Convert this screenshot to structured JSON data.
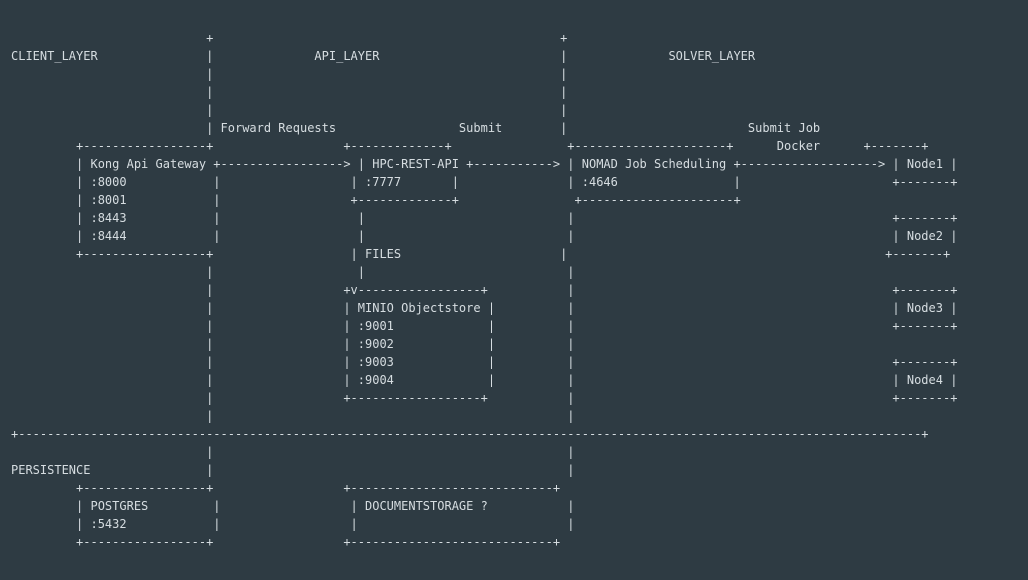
{
  "diagram": {
    "lines": [
      "                           +                                                +",
      "CLIENT_LAYER               |              API_LAYER                         |              SOLVER_LAYER",
      "                           |                                                |",
      "                           |                                                |",
      "                           |                                                |",
      "                           | Forward Requests                 Submit        |                         Submit Job",
      "         +-----------------+                  +-------------+                +---------------------+      Docker      +-------+",
      "         | Kong Api Gateway +-----------------> | HPC-REST-API +-----------> | NOMAD Job Scheduling +-------------------> | Node1 |",
      "         | :8000            |                  | :7777       |               | :4646                |                     +-------+",
      "         | :8001            |                  +-------------+                +---------------------+",
      "         | :8443            |                   |                            |                                            +-------+",
      "         | :8444            |                   |                            |                                            | Node2 |",
      "         +-----------------+                   | FILES                      |                                            +-------+",
      "                           |                    |                            |",
      "                           |                  +v-----------------+           |                                            +-------+",
      "                           |                  | MINIO Objectstore |          |                                            | Node3 |",
      "                           |                  | :9001             |          |                                            +-------+",
      "                           |                  | :9002             |          |",
      "                           |                  | :9003             |          |                                            +-------+",
      "                           |                  | :9004             |          |                                            | Node4 |",
      "                           |                  +------------------+           |                                            +-------+",
      "                           |                                                 |",
      "+-----------------------------------------------------------------------------------------------------------------------------+",
      "                           |                                                 |",
      "PERSISTENCE                |                                                 |",
      "         +-----------------+                  +----------------------------+",
      "         | POSTGRES         |                  | DOCUMENTSTORAGE ?           |",
      "         | :5432            |                  |                             |",
      "         +-----------------+                  +----------------------------+"
    ]
  }
}
